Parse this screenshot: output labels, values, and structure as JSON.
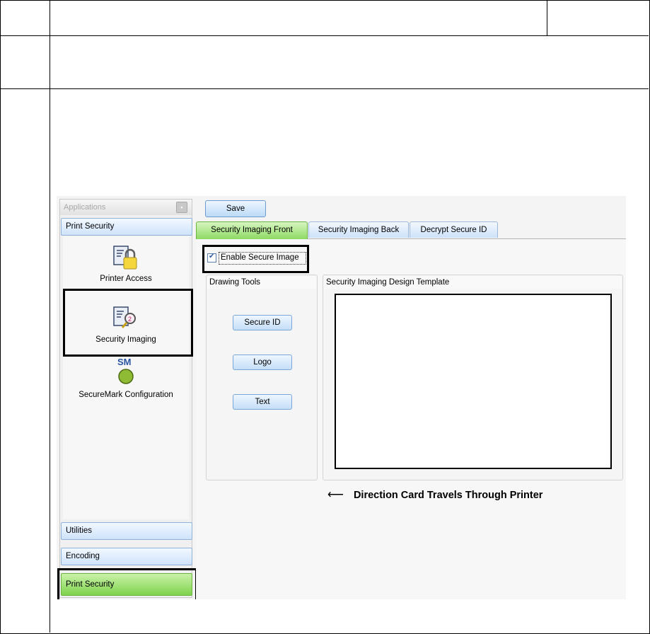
{
  "app": {
    "panel_title": "Applications",
    "group_top": "Print Security",
    "items": [
      {
        "label": "Printer Access",
        "icon": "padlock-card-icon"
      },
      {
        "label": "Security Imaging",
        "icon": "magnifier-card-icon"
      },
      {
        "label": "SecureMark Configuration",
        "icon": "securemark-icon",
        "icon_text": "SM"
      }
    ],
    "bottom_groups": [
      "Utilities",
      "Encoding",
      "Print Security"
    ]
  },
  "toolbar": {
    "save_label": "Save"
  },
  "tabs": [
    {
      "label": "Security Imaging Front",
      "active": true
    },
    {
      "label": "Security Imaging Back",
      "active": false
    },
    {
      "label": "Decrypt Secure ID",
      "active": false
    }
  ],
  "front": {
    "enable_label": "Enable Secure Image",
    "enable_checked": true,
    "drawing_tools_title": "Drawing Tools",
    "tools": [
      "Secure ID",
      "Logo",
      "Text"
    ],
    "template_title": "Security Imaging Design Template",
    "direction_text": "Direction Card Travels Through Printer"
  },
  "colors": {
    "active_green": "#8ed963",
    "group_blue": "#cfe3fb"
  }
}
